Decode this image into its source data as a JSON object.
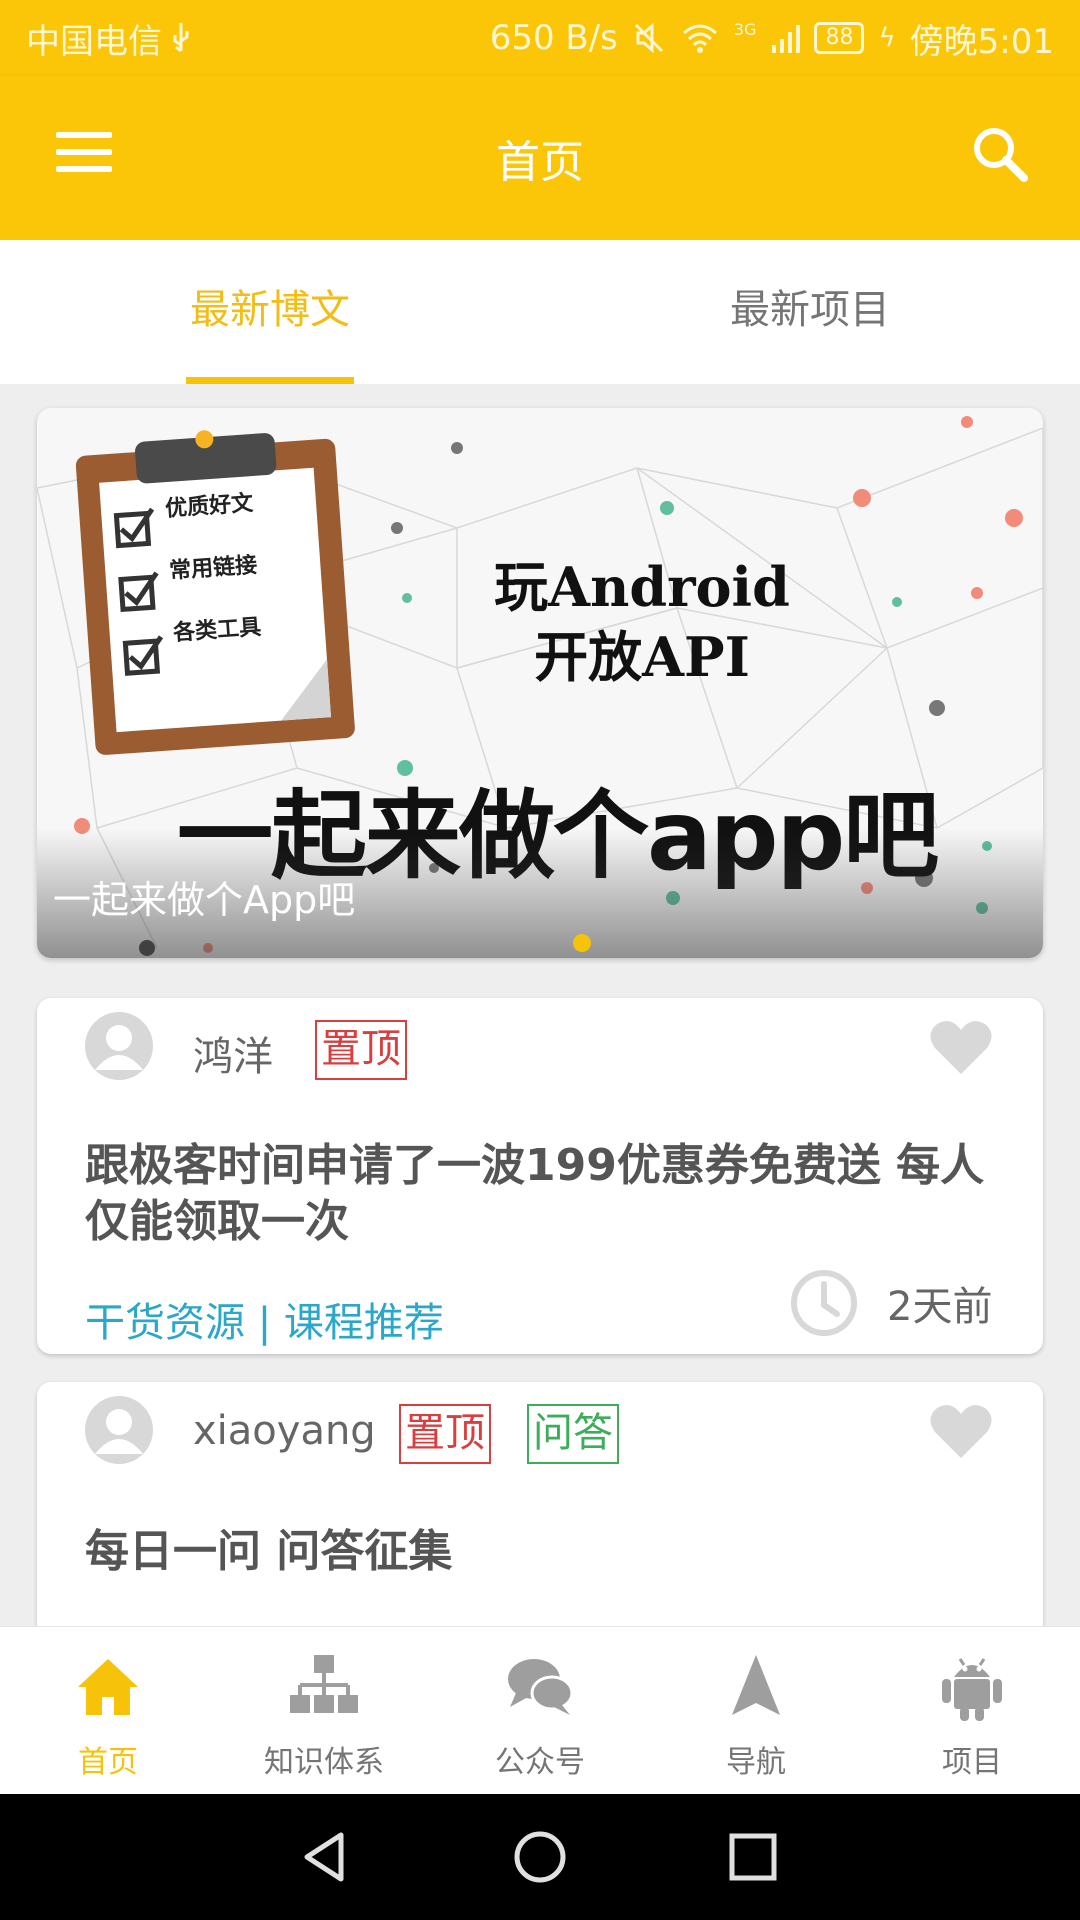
{
  "status_bar": {
    "carrier": "中国电信",
    "speed": "650 B/s",
    "network": "3G",
    "battery": "88",
    "time": "傍晚5:01"
  },
  "app_bar": {
    "title": "首页",
    "menu_icon": "hamburger-icon",
    "search_icon": "search-icon"
  },
  "tabs": [
    {
      "label": "最新博文",
      "active": true
    },
    {
      "label": "最新项目",
      "active": false
    }
  ],
  "banner": {
    "caption": "一起来做个App吧",
    "checklist": [
      "优质好文",
      "常用链接",
      "各类工具"
    ],
    "headline1": "玩Android",
    "headline2": "开放API",
    "slogan": "一起来做个app吧"
  },
  "articles": [
    {
      "author": "鸿洋",
      "tags": [
        {
          "label": "置顶",
          "color": "#d93f3f"
        }
      ],
      "title": "跟极客时间申请了一波199优惠券免费送 每人仅能领取一次",
      "category": "干货资源 | 课程推荐",
      "time": "2天前"
    },
    {
      "author": "xiaoyang",
      "tags": [
        {
          "label": "置顶",
          "color": "#d93f3f"
        },
        {
          "label": "问答",
          "color": "#3dad5a"
        }
      ],
      "title": "每日一问 问答征集"
    }
  ],
  "bottom_nav": [
    {
      "label": "首页",
      "icon": "home-icon",
      "active": true
    },
    {
      "label": "知识体系",
      "icon": "hierarchy-icon",
      "active": false
    },
    {
      "label": "公众号",
      "icon": "chat-bubbles-icon",
      "active": false
    },
    {
      "label": "导航",
      "icon": "navigation-arrow-icon",
      "active": false
    },
    {
      "label": "项目",
      "icon": "android-icon",
      "active": false
    }
  ],
  "colors": {
    "primary": "#fbc607",
    "accent": "#f7c20a",
    "tag_red": "#d93f3f",
    "tag_green": "#3dad5a",
    "category_blue": "#2aa7c9"
  }
}
